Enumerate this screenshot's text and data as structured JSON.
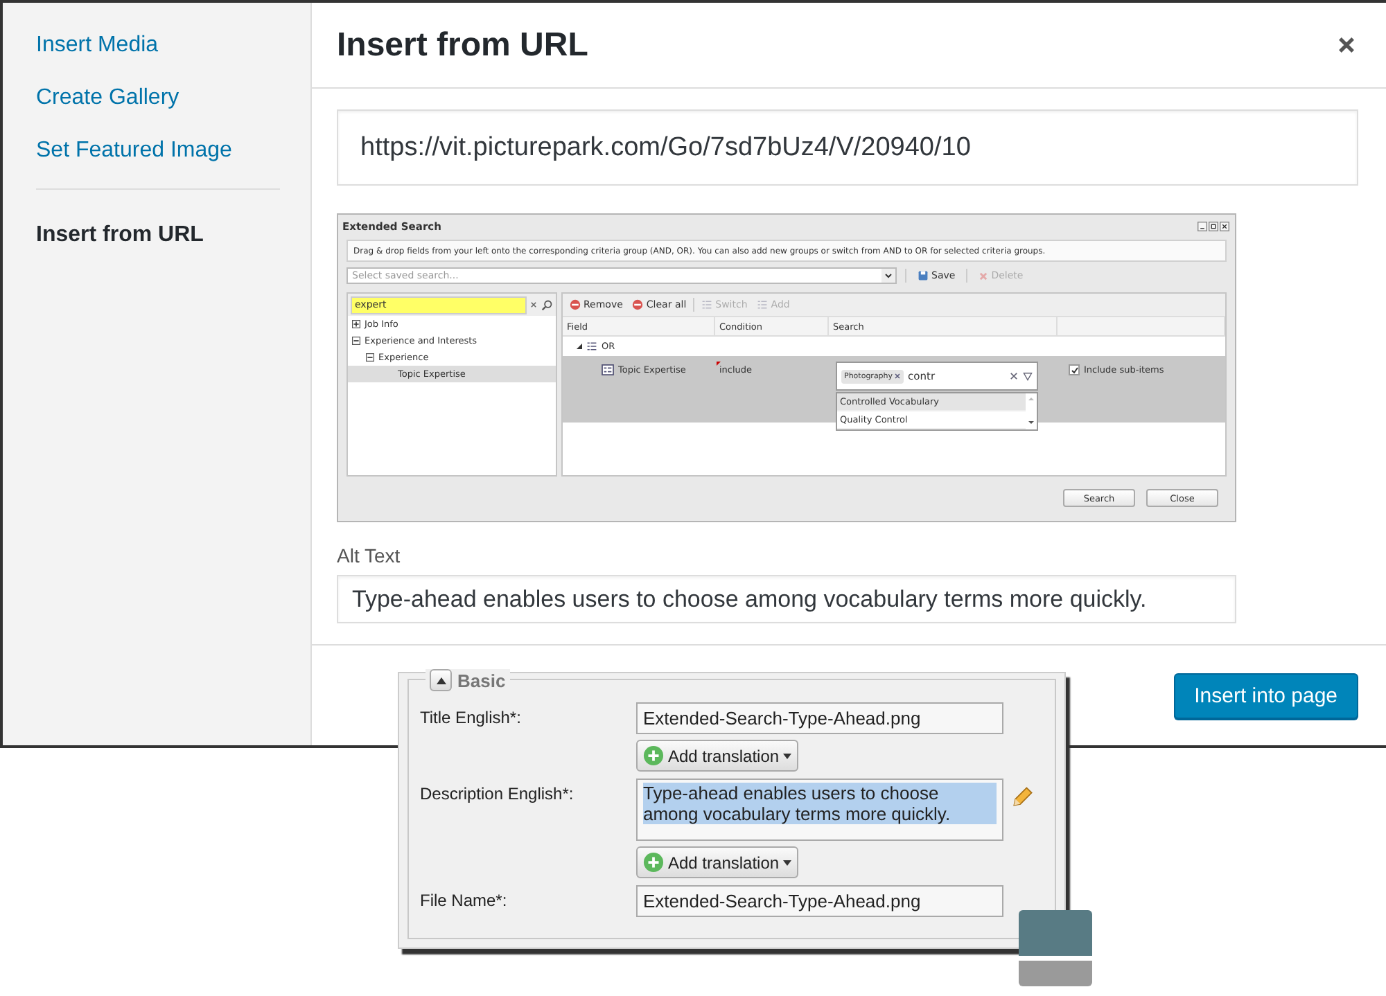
{
  "sidebar": {
    "groups": [
      {
        "items": [
          {
            "label": "Insert Media",
            "selected": false
          },
          {
            "label": "Create Gallery",
            "selected": false
          },
          {
            "label": "Set Featured Image",
            "selected": false
          }
        ]
      },
      {
        "items": [
          {
            "label": "Insert from URL",
            "selected": true
          }
        ]
      }
    ]
  },
  "header": {
    "title": "Insert from URL"
  },
  "url_field": {
    "value": "https://vit.picturepark.com/Go/7sd7bUz4/V/20940/10"
  },
  "embedded_screenshot": {
    "title": "Extended Search",
    "instructions": "Drag & drop fields from your left onto the corresponding criteria group (AND, OR). You can also add new groups or switch from AND to OR for selected criteria groups.",
    "saved_search": {
      "placeholder": "Select saved search..."
    },
    "toolbar": [
      {
        "label": "Save",
        "kind": "save",
        "disabled": false
      },
      {
        "label": "Delete",
        "kind": "delete",
        "disabled": true
      }
    ],
    "filter": {
      "value": "expert"
    },
    "tree": [
      {
        "label": "Job Info",
        "kind": "group",
        "expanded": false,
        "selected": false
      },
      {
        "label": "Experience and Interests",
        "kind": "group",
        "expanded": true,
        "selected": false,
        "children": [
          {
            "label": "Experience",
            "kind": "group",
            "expanded": true,
            "selected": false,
            "children": [
              {
                "label": "Topic Expertise",
                "kind": "field",
                "selected": true
              }
            ]
          }
        ]
      }
    ],
    "criteria_toolbar": [
      {
        "label": "Remove",
        "kind": "remove",
        "disabled": false
      },
      {
        "label": "Clear all",
        "kind": "remove",
        "disabled": false
      },
      {
        "label": "Switch",
        "kind": "switch",
        "disabled": true
      },
      {
        "label": "Add",
        "kind": "switch",
        "disabled": true
      }
    ],
    "columns": [
      "Field",
      "Condition",
      "Search"
    ],
    "group": {
      "label": "OR"
    },
    "rows": [
      {
        "field": "Topic Expertise",
        "condition": "include",
        "tags": [
          "Photography"
        ],
        "query": "contr",
        "include_sub_items": {
          "label": "Include sub-items",
          "checked": true
        },
        "selected": true
      }
    ],
    "suggestions": [
      {
        "label": "Controlled Vocabulary",
        "selected": true
      },
      {
        "label": "Quality Control",
        "selected": false
      }
    ],
    "buttons": [
      "Search",
      "Close"
    ]
  },
  "alt_text": {
    "label": "Alt Text",
    "value": "Type-ahead enables users to choose among vocabulary terms more quickly."
  },
  "footer": {
    "button": "Insert into page"
  },
  "overlay_panel": {
    "title": "Basic",
    "fields": [
      {
        "label": "Title English*:",
        "kind": "text",
        "value": "Extended-Search-Type-Ahead.png",
        "highlighted": false,
        "translation_button": "Add translation"
      },
      {
        "label": "Description English*:",
        "kind": "textarea",
        "value": "Type-ahead enables users to choose among vocabulary terms more quickly.",
        "highlighted": true,
        "translation_button": "Add translation"
      },
      {
        "label": "File Name*:",
        "kind": "text",
        "value": "Extended-Search-Type-Ahead.png",
        "highlighted": false
      }
    ]
  }
}
